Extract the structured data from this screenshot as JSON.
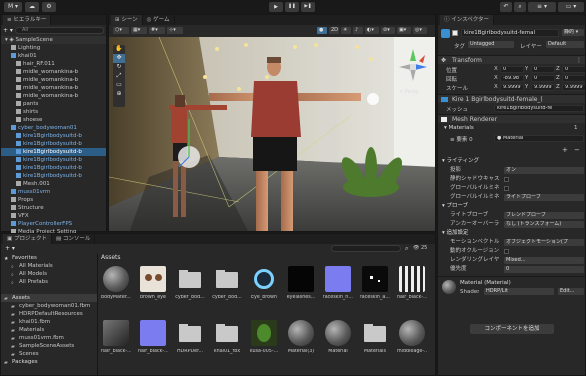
{
  "toolbar": {
    "account": "M",
    "play": "▶",
    "pause": "❚❚",
    "step": "▶❚",
    "search": "⌕",
    "layers": "≡"
  },
  "hierarchy": {
    "tab": "ヒエラルキー",
    "search_placeholder": "All",
    "scene": "SampleScene",
    "rows": [
      {
        "label": "Lighting",
        "indent": 2,
        "selected": false
      },
      {
        "label": "khai01",
        "indent": 2,
        "selected": false
      },
      {
        "label": "hair_RF.011",
        "indent": 3,
        "selected": false
      },
      {
        "label": "midle_womankina-b",
        "indent": 3,
        "selected": false
      },
      {
        "label": "midle_womankina-b",
        "indent": 3,
        "selected": false
      },
      {
        "label": "midle_womankina-b",
        "indent": 3,
        "selected": false
      },
      {
        "label": "midle_womankina-b",
        "indent": 3,
        "selected": false
      },
      {
        "label": "pants",
        "indent": 3,
        "selected": false
      },
      {
        "label": "shirts",
        "indent": 3,
        "selected": false
      },
      {
        "label": "shoese",
        "indent": 3,
        "selected": false
      },
      {
        "label": "cyber_bodywoman01",
        "indent": 2,
        "selected": false
      },
      {
        "label": "kire1Bgirlbodysuitd-b",
        "indent": 3,
        "selected": false
      },
      {
        "label": "kire1Bgirlbodysuitd-b",
        "indent": 3,
        "selected": false
      },
      {
        "label": "kire1Bgirlbodysuitd-b",
        "indent": 3,
        "selected": true
      },
      {
        "label": "kire1Bgirlbodysuitd-b",
        "indent": 3,
        "selected": false
      },
      {
        "label": "kire1Bgirlbodysuitd-b",
        "indent": 3,
        "selected": false
      },
      {
        "label": "kire1Bgirlbodysuitd-b",
        "indent": 3,
        "selected": false
      },
      {
        "label": "Mesh.001",
        "indent": 3,
        "selected": false
      },
      {
        "label": "muss01vrm",
        "indent": 2,
        "selected": false
      },
      {
        "label": "Props",
        "indent": 2,
        "selected": false
      },
      {
        "label": "Structure",
        "indent": 2,
        "selected": false
      },
      {
        "label": "VFX",
        "indent": 2,
        "selected": false
      },
      {
        "label": "PlayerControllerFPS",
        "indent": 2,
        "selected": false
      },
      {
        "label": "Media Project Setting",
        "indent": 2,
        "selected": false
      }
    ]
  },
  "scene": {
    "tab_scene": "シーン",
    "tab_game": "ゲーム",
    "persp": "< Persp",
    "gizmo_y": "y",
    "gizmo_z": "z",
    "gizmo_x": "x"
  },
  "project": {
    "tab_project": "プロジェクト",
    "tab_console": "コンソール",
    "count": "25",
    "tree": [
      {
        "label": "Favorites",
        "indent": 0,
        "bold": true
      },
      {
        "label": "All Materials",
        "indent": 1,
        "bold": false
      },
      {
        "label": "All Models",
        "indent": 1,
        "bold": false
      },
      {
        "label": "All Prefabs",
        "indent": 1,
        "bold": false
      },
      {
        "label": "",
        "indent": 0,
        "bold": false
      },
      {
        "label": "Assets",
        "indent": 0,
        "bold": true
      },
      {
        "label": "cyber_bodywoman01.fbm",
        "indent": 1,
        "bold": false
      },
      {
        "label": "HDRPDefaultResources",
        "indent": 1,
        "bold": false
      },
      {
        "label": "khai01.fbm",
        "indent": 1,
        "bold": false
      },
      {
        "label": "Materials",
        "indent": 1,
        "bold": false
      },
      {
        "label": "muss01vrm.fbm",
        "indent": 1,
        "bold": false
      },
      {
        "label": "SampleSceneAssets",
        "indent": 1,
        "bold": false
      },
      {
        "label": "Scenes",
        "indent": 1,
        "bold": false
      },
      {
        "label": "Packages",
        "indent": 0,
        "bold": true
      }
    ],
    "assets_label": "Assets",
    "grid_row1": [
      {
        "name": "bodyMater...",
        "kind": "sphere"
      },
      {
        "name": "brown_eye",
        "kind": "eye"
      },
      {
        "name": "cyber_bod...",
        "kind": "folder"
      },
      {
        "name": "cyber_bod...",
        "kind": "folder"
      },
      {
        "name": "Eye_brown",
        "kind": "ring"
      },
      {
        "name": "eyelashes...",
        "kind": "black"
      },
      {
        "name": "faceskin_n...",
        "kind": "blue"
      },
      {
        "name": "faceskin_a...",
        "kind": "dots"
      },
      {
        "name": "hair_black-...",
        "kind": "stripes"
      }
    ],
    "grid_row2": [
      {
        "name": "hair_black-...",
        "kind": "tex"
      },
      {
        "name": "hair_black-...",
        "kind": "blue"
      },
      {
        "name": "HDRPDef...",
        "kind": "folder"
      },
      {
        "name": "khai01_fbx",
        "kind": "folder"
      },
      {
        "name": "kusa-005-...",
        "kind": "plant"
      },
      {
        "name": "Material(3)",
        "kind": "sphere"
      },
      {
        "name": "Material",
        "kind": "sphere"
      },
      {
        "name": "Materials",
        "kind": "folder"
      },
      {
        "name": "middleage-...",
        "kind": "sphere"
      }
    ]
  },
  "inspector": {
    "tab": "インスペクター",
    "object_name": "kire1Bgirlbodysuitd-femal",
    "static_label": "静的",
    "tag_label": "タグ",
    "tag_value": "Untagged",
    "layer_label": "レイヤー",
    "layer_value": "Default",
    "transform": {
      "title": "Transform",
      "pos_label": "位置",
      "rot_label": "回転",
      "scale_label": "スケール",
      "pos": [
        "0",
        "0",
        "0"
      ],
      "rot": [
        "-89.98",
        "0",
        "0"
      ],
      "scale": [
        "9.9999",
        "9.9999",
        "9.9999"
      ]
    },
    "mesh_filter": {
      "title": "Kire 1 Bgirlbodysuitd-female_(",
      "mesh_label": "メッシュ",
      "mesh_value": "kire1Bgirlbodysuitd-fe"
    },
    "mesh_renderer": {
      "title": "Mesh Renderer",
      "materials_label": "Materials",
      "materials_count": "1",
      "element_label": "要素 0",
      "element_value": "Material"
    },
    "lighting": {
      "title": "ライティング",
      "rows": [
        {
          "label": "投影",
          "value": "オン"
        },
        {
          "label": "静的シャドウキャス",
          "value": ""
        },
        {
          "label": "グローバルイルミネ",
          "value": ""
        },
        {
          "label": "グローバルイルミネ",
          "value": "ライトプローブ"
        }
      ]
    },
    "probes": {
      "title": "プローブ",
      "rows": [
        {
          "label": "ライトプローブ",
          "value": "ブレンドプローブ"
        },
        {
          "label": "アンカーオーバーラ",
          "value": "なし (トランスフォーム)"
        }
      ]
    },
    "additional": {
      "title": "追加設定",
      "rows": [
        {
          "label": "モーションベクトル",
          "value": "オブジェクトモーション(プ"
        },
        {
          "label": "動的オクルージョン",
          "value": ""
        },
        {
          "label": "レンダリングレイヤ",
          "value": "Mixed..."
        },
        {
          "label": "優先度",
          "value": "0"
        }
      ]
    },
    "material": {
      "name": "Material (Material)",
      "shader_label": "Shader",
      "shader_value": "HDRP/Lit",
      "edit": "Edit..."
    },
    "add_component": "コンポーネントを追加"
  }
}
